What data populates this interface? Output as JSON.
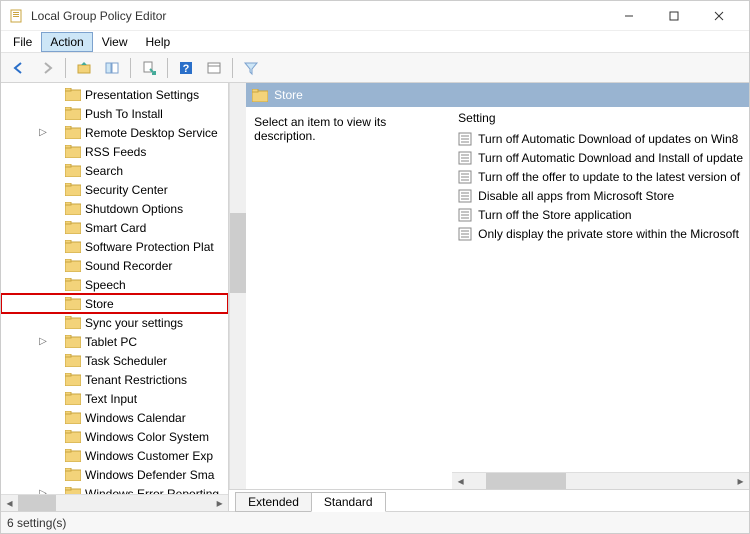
{
  "window": {
    "title": "Local Group Policy Editor"
  },
  "menu": {
    "file": "File",
    "action": "Action",
    "view": "View",
    "help": "Help"
  },
  "tree": {
    "items": [
      {
        "label": "Presentation Settings",
        "children": false
      },
      {
        "label": "Push To Install",
        "children": false
      },
      {
        "label": "Remote Desktop Service",
        "children": true
      },
      {
        "label": "RSS Feeds",
        "children": false
      },
      {
        "label": "Search",
        "children": false
      },
      {
        "label": "Security Center",
        "children": false
      },
      {
        "label": "Shutdown Options",
        "children": false
      },
      {
        "label": "Smart Card",
        "children": false
      },
      {
        "label": "Software Protection Plat",
        "children": false
      },
      {
        "label": "Sound Recorder",
        "children": false
      },
      {
        "label": "Speech",
        "children": false
      },
      {
        "label": "Store",
        "children": false,
        "highlight": true
      },
      {
        "label": "Sync your settings",
        "children": false
      },
      {
        "label": "Tablet PC",
        "children": true
      },
      {
        "label": "Task Scheduler",
        "children": false
      },
      {
        "label": "Tenant Restrictions",
        "children": false
      },
      {
        "label": "Text Input",
        "children": false
      },
      {
        "label": "Windows Calendar",
        "children": false
      },
      {
        "label": "Windows Color System",
        "children": false
      },
      {
        "label": "Windows Customer Exp",
        "children": false
      },
      {
        "label": "Windows Defender Sma",
        "children": false
      },
      {
        "label": "Windows Error Reporting",
        "children": true
      }
    ]
  },
  "details": {
    "header": "Store",
    "description": "Select an item to view its description.",
    "column_header": "Setting",
    "settings": [
      "Turn off Automatic Download of updates on Win8",
      "Turn off Automatic Download and Install of update",
      "Turn off the offer to update to the latest version of",
      "Disable all apps from Microsoft Store",
      "Turn off the Store application",
      "Only display the private store within the Microsoft"
    ]
  },
  "tabs": {
    "extended": "Extended",
    "standard": "Standard"
  },
  "status": "6 setting(s)"
}
